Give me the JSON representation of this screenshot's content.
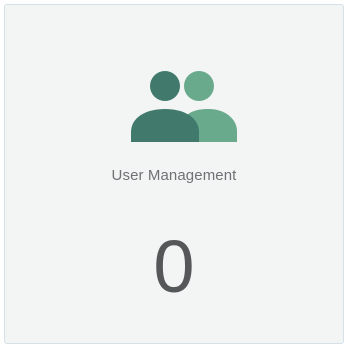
{
  "card": {
    "title": "User Management",
    "count": "0",
    "icon": "users-icon",
    "colors": {
      "background": "#f3f4f4",
      "border": "#d6e0e8",
      "icon_primary": "#417a6d",
      "icon_secondary": "#6aaa8c",
      "title_text": "#6f7275",
      "count_text": "#555859"
    }
  }
}
